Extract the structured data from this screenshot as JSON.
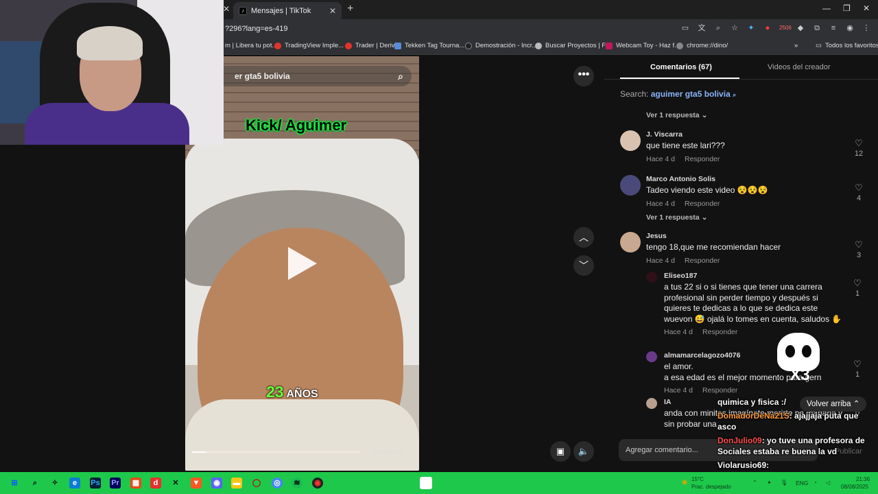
{
  "browser": {
    "tab_title": "Mensajes | TikTok",
    "url": "?296?lang=es-419",
    "bookmarks": [
      "m | Libera tu pot...",
      "TradingView Imple...",
      "Trader | Deriv",
      "Tekken Tag Tourna...",
      "Demostración - Incr...",
      "Buscar Proyectos | F...",
      "Webcam Toy - Haz f...",
      "chrome://dino/"
    ],
    "all_bookmarks": "Todos los favoritos",
    "badge_count": "2506"
  },
  "video": {
    "search_text": "er gta5 bolivia",
    "overlay_title": "Kick/ Aguimer",
    "age_number": "23",
    "age_word": "AÑOS",
    "time": "00:01/00:53",
    "progress": 0.08
  },
  "panel": {
    "tab_comments": "Comentarios (67)",
    "tab_videos": "Videos del creador",
    "search_label": "Search:",
    "search_query": "aguimer gta5 bolivia",
    "reply_toggle": "Ver 1 respuesta",
    "time_label": "Hace 4 d",
    "reply_label": "Responder",
    "comments": [
      {
        "name": "J. Viscarra",
        "text": "que tiene este lari???",
        "likes": "12"
      },
      {
        "name": "Marco Antonio Solis",
        "text": "Tadeo viendo este video 😵😵😵",
        "likes": "4"
      },
      {
        "name": "Jesus",
        "text": "tengo 18,que me recomiendan hacer",
        "likes": "3"
      }
    ],
    "replies": [
      {
        "name": "Eliseo187",
        "text": "a tus 22 si o si tienes que tener una carrera profesional sin perder tiempo y después si quieres te dedicas a lo que se dedica este wuevon 😅 ojalá lo tomes en cuenta, saludos ✋",
        "likes": "1"
      },
      {
        "name": "almamarcelagozo4076",
        "text": "el amor.\na esa edad es el mejor momento para gern",
        "likes": "1"
      },
      {
        "name": "IA",
        "text": "anda con minitas imagínate morirte pa mañana y sin probar una",
        "likes": "0"
      }
    ],
    "back_to_top": "Volver arriba",
    "composer_placeholder": "Agregar comentario...",
    "publish": "Publicar"
  },
  "chat": [
    {
      "user": "",
      "msg": "quimica y fisica :/"
    },
    {
      "user": "DomadorDeNa21S",
      "msg": ": ajajjaja puta que asco"
    },
    {
      "user": "DonJulio09",
      "msg": ": yo tuve una profesora de Sociales estaba re buena la vd"
    },
    {
      "user": "Violarusio69",
      "msg": ":"
    }
  ],
  "sticker_text": "X3",
  "taskbar": {
    "weather_temp": "15°C",
    "weather_desc": "Prac. despejado",
    "lang": "ENG",
    "time": "21:36",
    "date": "08/08/2025"
  },
  "colors": {
    "taskbar": "#1ec84a",
    "link": "#8ab4f8",
    "kick_glow": "#00ff3c"
  }
}
